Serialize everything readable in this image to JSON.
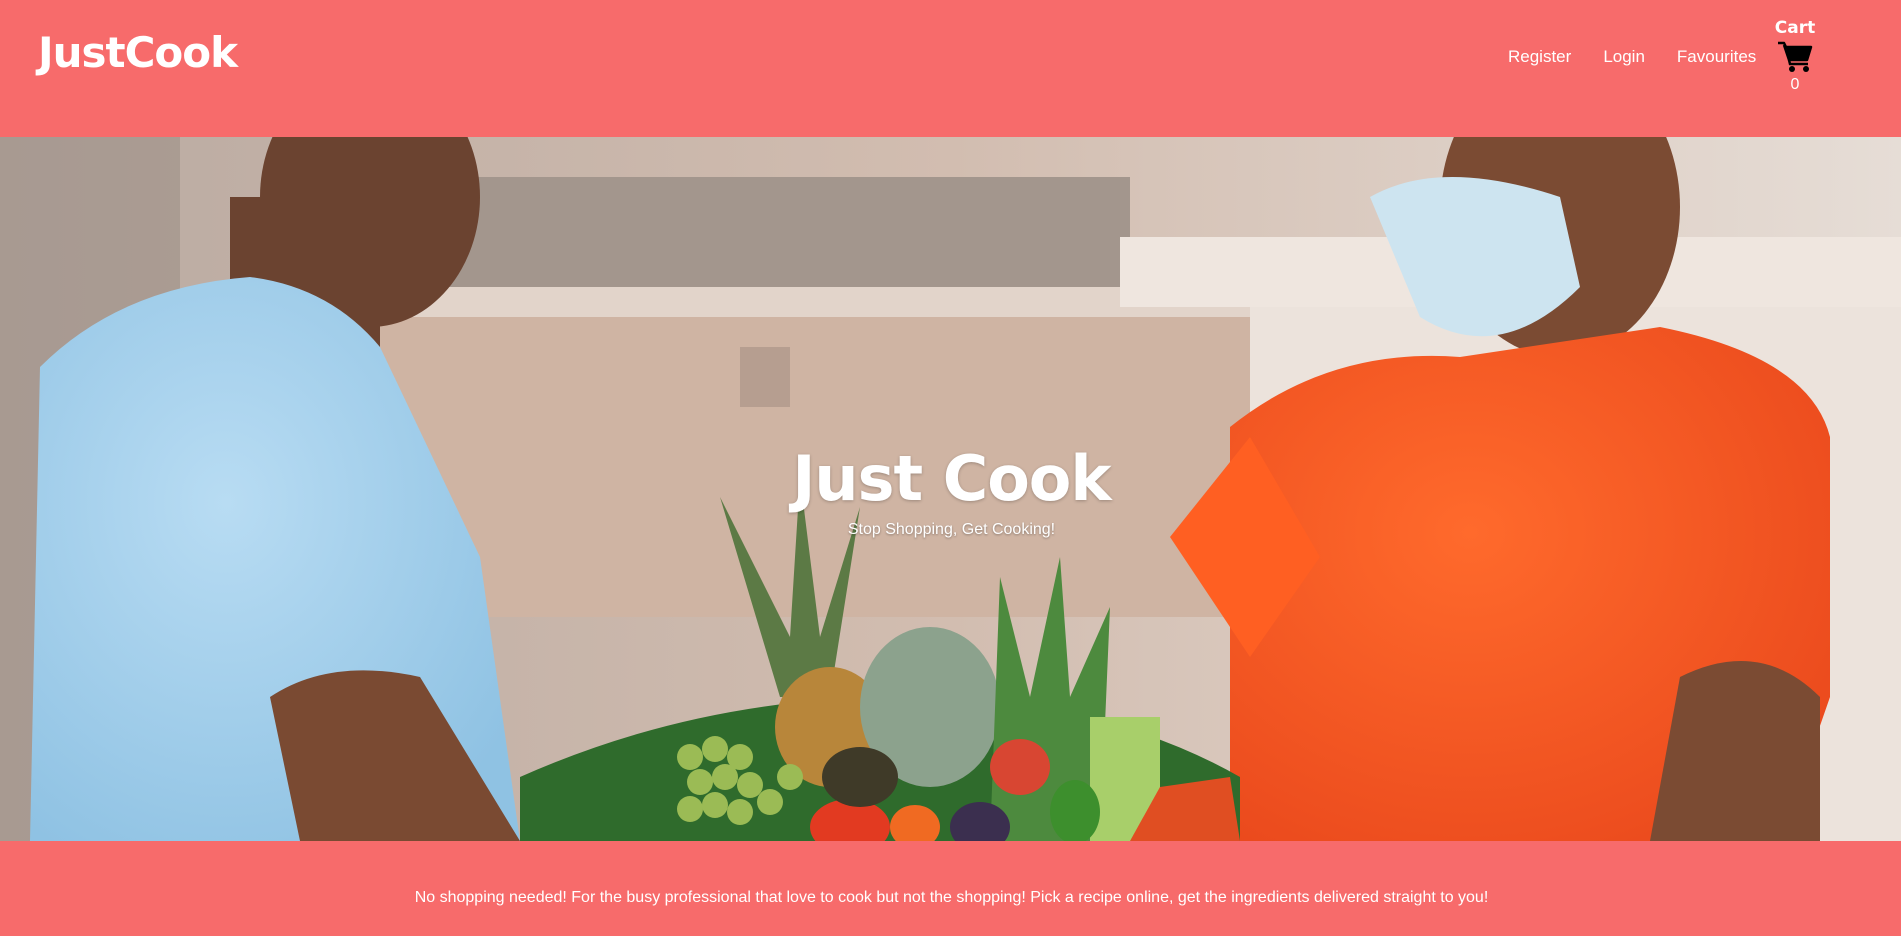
{
  "header": {
    "logo": "JustCook",
    "nav": {
      "register": "Register",
      "login": "Login",
      "favourites": "Favourites"
    },
    "cart": {
      "label": "Cart",
      "count": "0",
      "icon": "shopping-cart-icon"
    }
  },
  "hero": {
    "title": "Just Cook",
    "subtitle": "Stop Shopping, Get Cooking!"
  },
  "footer": {
    "text": "No shopping needed! For the busy professional that love to cook but not the shopping! Pick a recipe online, get the ingredients delivered straight to you!"
  },
  "colors": {
    "brand": "#f76b6b",
    "text_on_brand": "#ffffff"
  }
}
